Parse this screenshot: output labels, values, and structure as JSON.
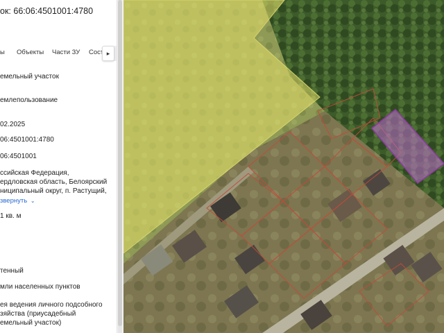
{
  "panel": {
    "title": "ок: 66:06:4501001:4780",
    "tabs": [
      "ы",
      "Объекты",
      "Части ЗУ",
      "Сост"
    ],
    "tab_scroll_icon": "chevron-right-icon",
    "fields": [
      {
        "lines": [
          "емельный участок"
        ]
      },
      {
        "lines": [
          "емлепользование"
        ]
      },
      {
        "lines": [
          "02.2025"
        ]
      },
      {
        "lines": [
          "06:4501001:4780"
        ]
      },
      {
        "lines": [
          "06:4501001"
        ]
      },
      {
        "lines": [
          "ссийская Федерация,",
          "ердловская область, Белоярский",
          "ниципальный округ, п. Растущий,"
        ]
      },
      {
        "lines": [
          "1 кв. м"
        ]
      },
      {
        "lines": [
          "тенный"
        ]
      },
      {
        "lines": [
          "мли населенных пунктов"
        ]
      },
      {
        "lines": [
          "ея ведения личного подсобного",
          "зяйства (приусадебный",
          "емельный участок)"
        ]
      }
    ],
    "expand_link": "звернуть",
    "expand_icon": "chevron-down-icon"
  },
  "map": {
    "colors": {
      "yellow_zone": "#e6e06a",
      "selected_parcel": "#c06fd0",
      "parcel_border": "#c44a3a",
      "zone_border": "#d8d36a"
    }
  }
}
